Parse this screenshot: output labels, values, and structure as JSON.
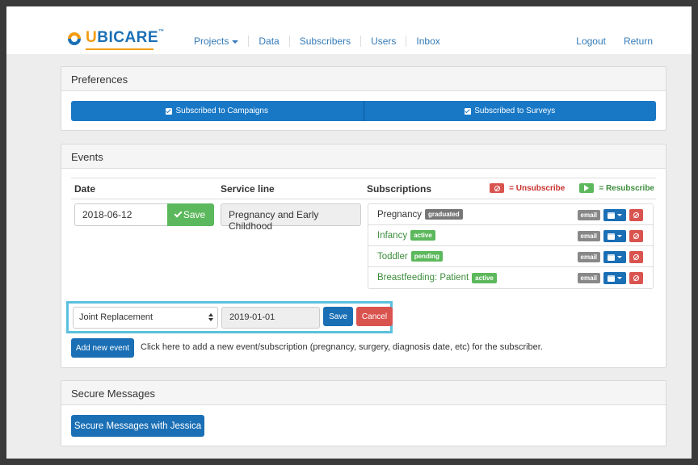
{
  "brand": {
    "logo_text": "UBICARE",
    "logo_u": "U",
    "logo_rest": "BICARE",
    "tm": "™"
  },
  "nav": {
    "items": [
      {
        "label": "Projects",
        "dropdown": true
      },
      {
        "label": "Data"
      },
      {
        "label": "Subscribers"
      },
      {
        "label": "Users"
      },
      {
        "label": "Inbox"
      }
    ],
    "right": [
      {
        "label": "Logout"
      },
      {
        "label": "Return"
      }
    ]
  },
  "preferences": {
    "heading": "Preferences",
    "campaigns_label": "Subscribed to Campaigns",
    "surveys_label": "Subscribed to Surveys"
  },
  "events": {
    "heading": "Events",
    "col_date": "Date",
    "col_service": "Service line",
    "col_subs": "Subscriptions",
    "legend_unsub": "= Unsubscribe",
    "legend_resub": "= Resubscribe",
    "row": {
      "date": "2018-06-12",
      "save_label": "Save",
      "service": "Pregnancy and Early Childhood"
    },
    "subscriptions": [
      {
        "name": "Pregnancy",
        "status": "graduated",
        "email_label": "email"
      },
      {
        "name": "Infancy",
        "status": "active",
        "email_label": "email"
      },
      {
        "name": "Toddler",
        "status": "pending",
        "email_label": "email"
      },
      {
        "name": "Breastfeeding: Patient",
        "status": "active",
        "email_label": "email"
      }
    ],
    "new_event": {
      "select_value": "Joint Replacement",
      "date_value": "2019-01-01",
      "save_label": "Save",
      "cancel_label": "Cancel"
    },
    "add_button_label": "Add new event",
    "add_help": "Click here to add a new event/subscription (pregnancy, surgery, diagnosis date, etc) for the subscriber."
  },
  "secure_messages": {
    "heading": "Secure Messages",
    "button_label": "Secure Messages with Jessica"
  },
  "colors": {
    "primary": "#1a6fb5",
    "success": "#5cb85c",
    "danger": "#d9534f",
    "brand_orange": "#f39c12"
  }
}
